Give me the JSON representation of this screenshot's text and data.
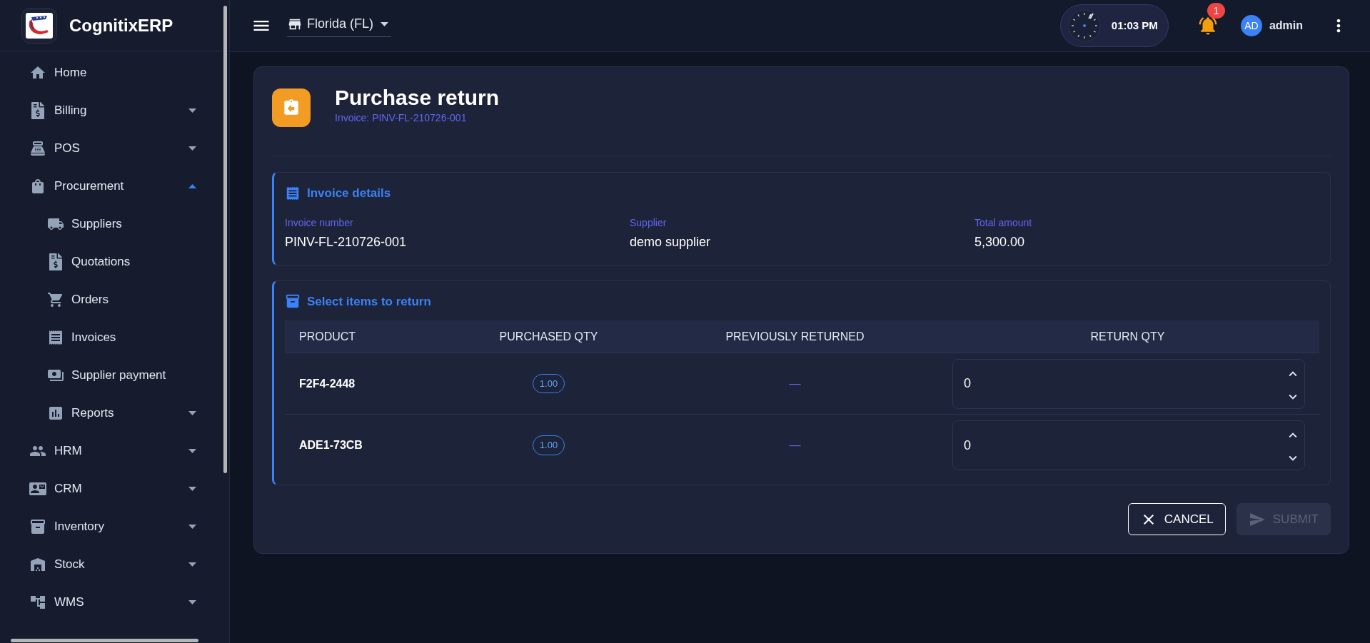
{
  "sidebar": {
    "brand": "CognitixERP",
    "items": [
      {
        "label": "Home",
        "kind": "link"
      },
      {
        "label": "Billing",
        "kind": "group",
        "expanded": false
      },
      {
        "label": "POS",
        "kind": "group",
        "expanded": false
      },
      {
        "label": "Procurement",
        "kind": "group",
        "expanded": true,
        "children": [
          {
            "label": "Suppliers",
            "kind": "link"
          },
          {
            "label": "Quotations",
            "kind": "link"
          },
          {
            "label": "Orders",
            "kind": "link"
          },
          {
            "label": "Invoices",
            "kind": "link"
          },
          {
            "label": "Supplier payment",
            "kind": "link"
          },
          {
            "label": "Reports",
            "kind": "group",
            "expanded": false
          }
        ]
      },
      {
        "label": "HRM",
        "kind": "group",
        "expanded": false
      },
      {
        "label": "CRM",
        "kind": "group",
        "expanded": false
      },
      {
        "label": "Inventory",
        "kind": "group",
        "expanded": false
      },
      {
        "label": "Stock",
        "kind": "group",
        "expanded": false
      },
      {
        "label": "WMS",
        "kind": "group",
        "expanded": false
      }
    ]
  },
  "header": {
    "store": "Florida (FL)",
    "time": "01:03 PM",
    "notifications": "1",
    "user": {
      "initials": "AD",
      "name": "admin"
    }
  },
  "page": {
    "title": "Purchase return",
    "subtitle": "Invoice: PINV-FL-210726-001",
    "invoice_details": {
      "title": "Invoice details",
      "fields": [
        {
          "label": "Invoice number",
          "value": "PINV-FL-210726-001"
        },
        {
          "label": "Supplier",
          "value": "demo supplier"
        },
        {
          "label": "Total amount",
          "value": "5,300.00"
        }
      ]
    },
    "items": {
      "title": "Select items to return",
      "columns": [
        "PRODUCT",
        "PURCHASED QTY",
        "PREVIOUSLY RETURNED",
        "RETURN QTY"
      ],
      "rows": [
        {
          "product": "F2F4-2448",
          "purchased_qty": "1.00",
          "previously_returned": "—",
          "return_qty": "0"
        },
        {
          "product": "ADE1-73CB",
          "purchased_qty": "1.00",
          "previously_returned": "—",
          "return_qty": "0"
        }
      ]
    },
    "actions": [
      {
        "label": "CANCEL",
        "kind": "cancel",
        "disabled": false
      },
      {
        "label": "SUBMIT",
        "kind": "submit",
        "disabled": true
      }
    ]
  }
}
